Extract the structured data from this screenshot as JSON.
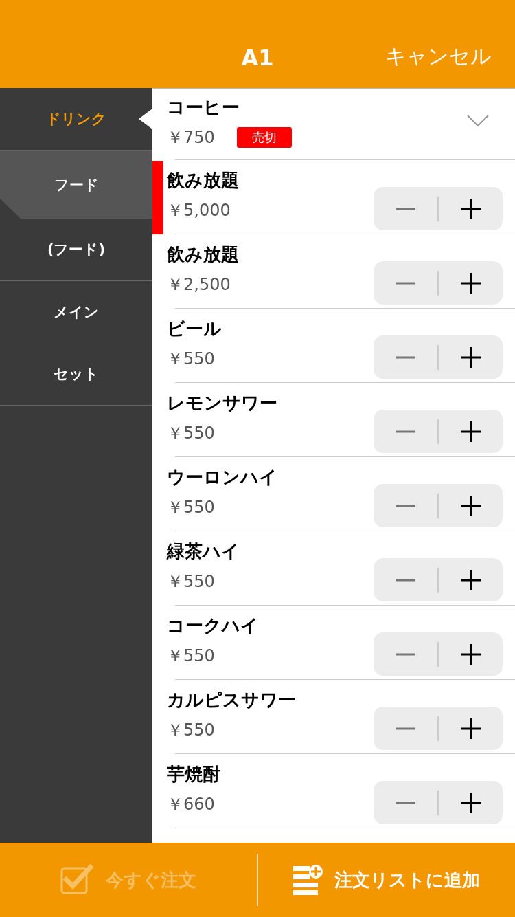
{
  "header": {
    "title": "A1",
    "cancel": "キャンセル"
  },
  "sidebar": {
    "groups": [
      {
        "items": [
          {
            "label": "ドリンク",
            "selected": true
          }
        ]
      },
      {
        "header": "フード",
        "items": [
          {
            "label": "(フード)",
            "selected": false
          }
        ]
      },
      {
        "items": [
          {
            "label": "メイン",
            "selected": false
          },
          {
            "label": "セット",
            "selected": false
          }
        ]
      }
    ]
  },
  "menu_items": [
    {
      "kind": "sold_out",
      "name": "コーヒー",
      "price": "￥750",
      "badge": "売切",
      "marked": false
    },
    {
      "kind": "stepper",
      "name": "飲み放題",
      "price": "￥5,000",
      "marked": true
    },
    {
      "kind": "stepper",
      "name": "飲み放題",
      "price": "￥2,500",
      "marked": false
    },
    {
      "kind": "stepper",
      "name": "ビール",
      "price": "￥550",
      "marked": false
    },
    {
      "kind": "stepper",
      "name": "レモンサワー",
      "price": "￥550",
      "marked": false
    },
    {
      "kind": "stepper",
      "name": "ウーロンハイ",
      "price": "￥550",
      "marked": false
    },
    {
      "kind": "stepper",
      "name": "緑茶ハイ",
      "price": "￥550",
      "marked": false
    },
    {
      "kind": "stepper",
      "name": "コークハイ",
      "price": "￥550",
      "marked": false
    },
    {
      "kind": "stepper",
      "name": "カルピスサワー",
      "price": "￥550",
      "marked": false
    },
    {
      "kind": "stepper",
      "name": "芋焼酎",
      "price": "￥660",
      "marked": false
    }
  ],
  "bottom_bar": [
    {
      "label": "今すぐ注文",
      "kind": "order_now",
      "disabled": true
    },
    {
      "label": "注文リストに追加",
      "kind": "add_to_list",
      "disabled": false
    }
  ]
}
